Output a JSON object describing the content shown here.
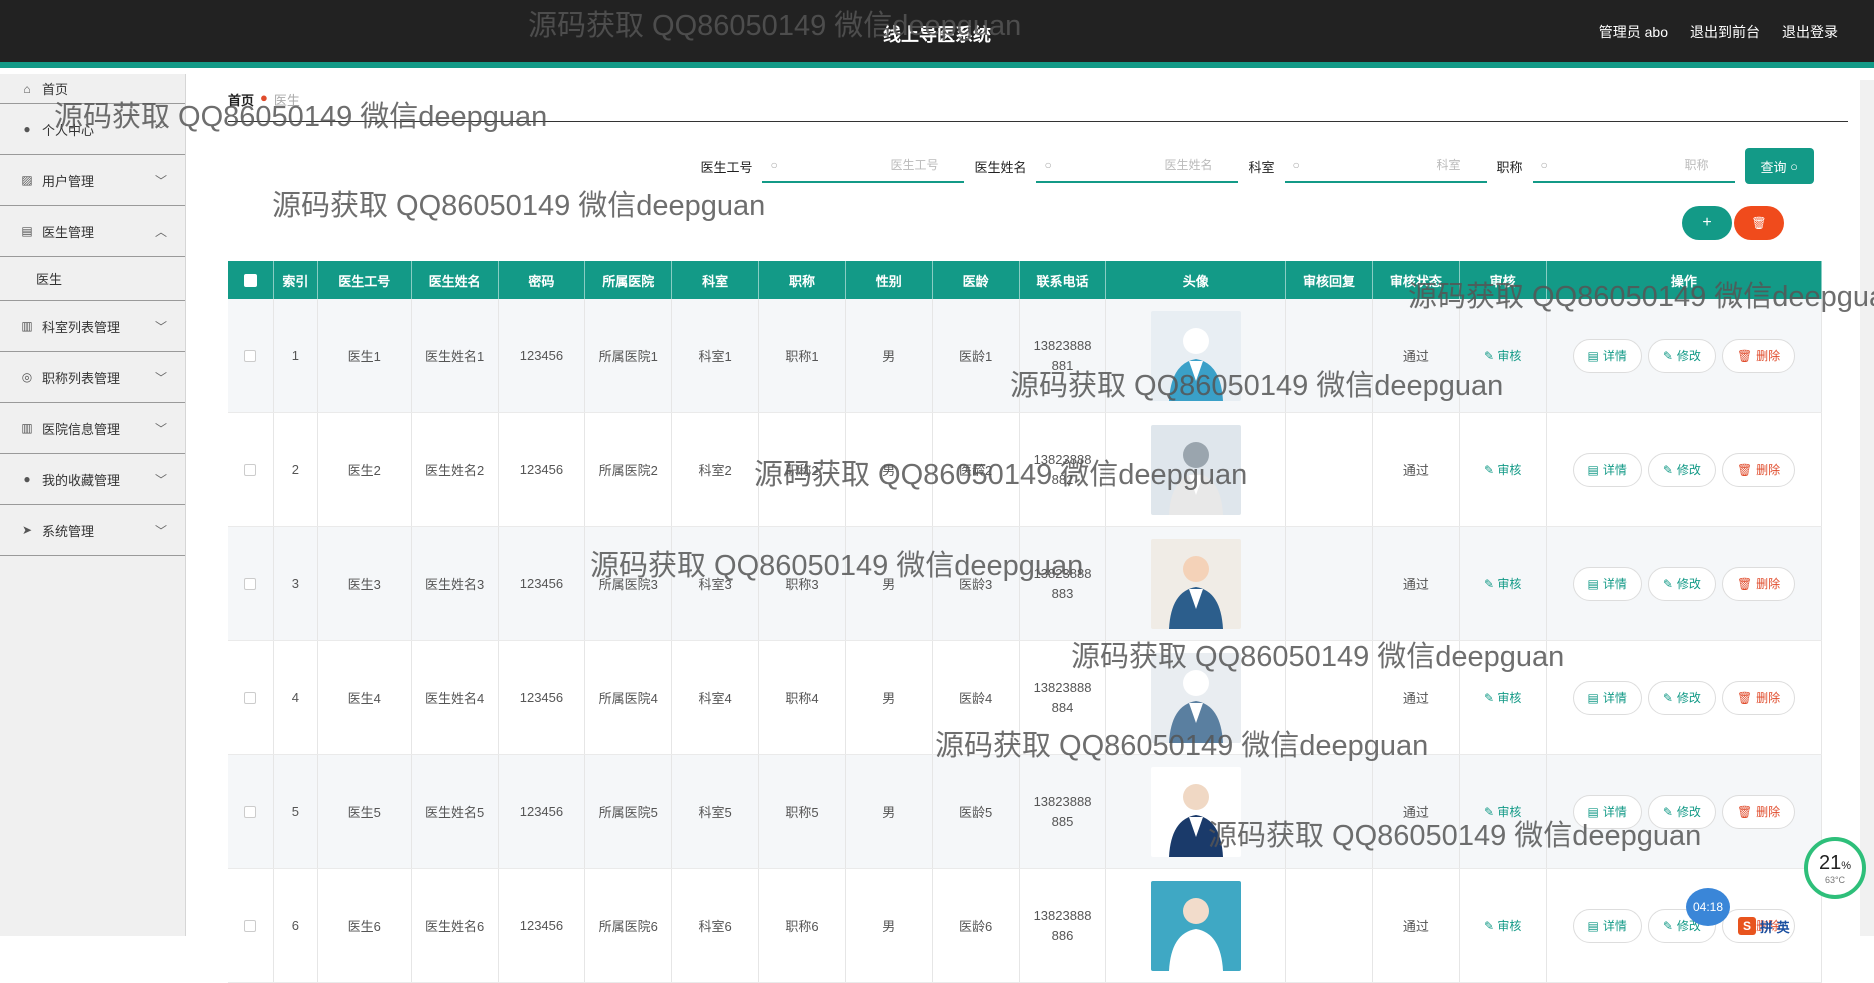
{
  "header": {
    "title": "线上导医系统",
    "user_label": "管理员 abo",
    "front_label": "退出到前台",
    "logout_label": "退出登录"
  },
  "sidebar": {
    "home": "首页",
    "items": [
      {
        "label": "个人中心",
        "icon": "user-icon"
      },
      {
        "label": "用户管理",
        "icon": "chart-icon"
      },
      {
        "label": "医生管理",
        "icon": "clipboard-icon",
        "expanded": true,
        "sub": "医生"
      },
      {
        "label": "科室列表管理",
        "icon": "bar-chart-icon"
      },
      {
        "label": "职称列表管理",
        "icon": "compass-icon"
      },
      {
        "label": "医院信息管理",
        "icon": "bar-chart-icon"
      },
      {
        "label": "我的收藏管理",
        "icon": "pin-icon"
      },
      {
        "label": "系统管理",
        "icon": "send-icon"
      }
    ]
  },
  "breadcrumb": {
    "home": "首页",
    "current": "医生"
  },
  "search": {
    "fields": [
      {
        "label": "医生工号",
        "placeholder": "医生工号"
      },
      {
        "label": "医生姓名",
        "placeholder": "医生姓名"
      },
      {
        "label": "科室",
        "placeholder": "科室"
      },
      {
        "label": "职称",
        "placeholder": "职称"
      }
    ],
    "query_label": "查询"
  },
  "table": {
    "headers": [
      "索引",
      "医生工号",
      "医生姓名",
      "密码",
      "所属医院",
      "科室",
      "职称",
      "性别",
      "医龄",
      "联系电话",
      "头像",
      "审核回复",
      "审核状态",
      "审核",
      "操作"
    ],
    "audit_label": "审核",
    "detail_label": "详情",
    "edit_label": "修改",
    "delete_label": "删除",
    "rows": [
      {
        "idx": "1",
        "id": "医生1",
        "name": "医生姓名1",
        "pwd": "123456",
        "hospital": "所属医院1",
        "dept": "科室1",
        "title": "职称1",
        "gender": "男",
        "age": "医龄1",
        "phone": "13823888881",
        "reply": "",
        "status": "通过"
      },
      {
        "idx": "2",
        "id": "医生2",
        "name": "医生姓名2",
        "pwd": "123456",
        "hospital": "所属医院2",
        "dept": "科室2",
        "title": "职称2",
        "gender": "男",
        "age": "医龄2",
        "phone": "13823888882",
        "reply": "",
        "status": "通过"
      },
      {
        "idx": "3",
        "id": "医生3",
        "name": "医生姓名3",
        "pwd": "123456",
        "hospital": "所属医院3",
        "dept": "科室3",
        "title": "职称3",
        "gender": "男",
        "age": "医龄3",
        "phone": "13823888883",
        "reply": "",
        "status": "通过"
      },
      {
        "idx": "4",
        "id": "医生4",
        "name": "医生姓名4",
        "pwd": "123456",
        "hospital": "所属医院4",
        "dept": "科室4",
        "title": "职称4",
        "gender": "男",
        "age": "医龄4",
        "phone": "13823888884",
        "reply": "",
        "status": "通过"
      },
      {
        "idx": "5",
        "id": "医生5",
        "name": "医生姓名5",
        "pwd": "123456",
        "hospital": "所属医院5",
        "dept": "科室5",
        "title": "职称5",
        "gender": "男",
        "age": "医龄5",
        "phone": "13823888885",
        "reply": "",
        "status": "通过"
      },
      {
        "idx": "6",
        "id": "医生6",
        "name": "医生姓名6",
        "pwd": "123456",
        "hospital": "所属医院6",
        "dept": "科室6",
        "title": "职称6",
        "gender": "男",
        "age": "医龄6",
        "phone": "13823888886",
        "reply": "",
        "status": "通过"
      }
    ]
  },
  "watermark": "源码获取 QQ86050149 微信deepguan",
  "system": {
    "cpu": "21",
    "cpu_unit": "%",
    "temp": "63°C",
    "time": "04:18",
    "ime": "拼 英"
  },
  "colors": {
    "accent": "#139a87",
    "danger": "#f04b1c",
    "header": "#222222"
  }
}
